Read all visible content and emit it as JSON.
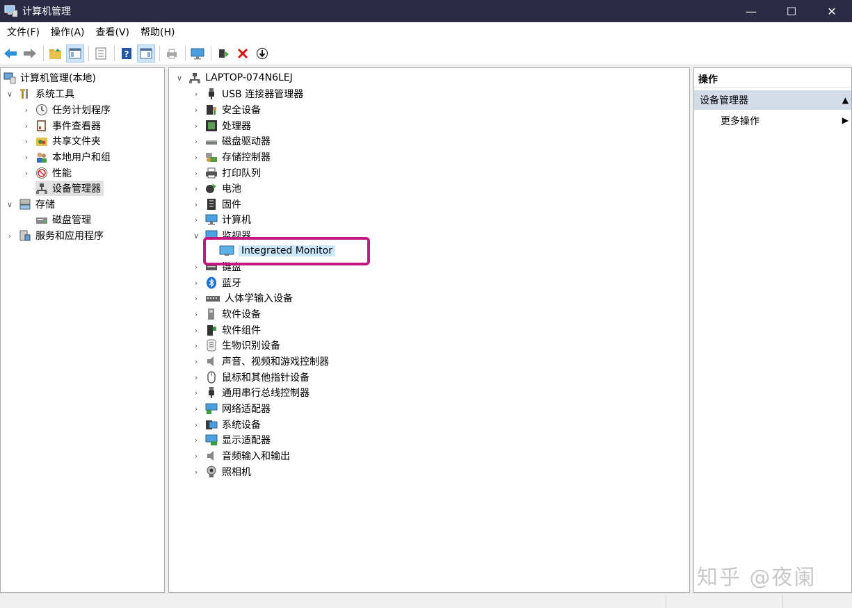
{
  "window": {
    "title": "计算机管理",
    "minimize": "—",
    "maximize": "☐",
    "close": "✕"
  },
  "menu": [
    "文件(F)",
    "操作(A)",
    "查看(V)",
    "帮助(H)"
  ],
  "left_tree": {
    "root": "计算机管理(本地)",
    "system_tools": "系统工具",
    "task_scheduler": "任务计划程序",
    "event_viewer": "事件查看器",
    "shared_folders": "共享文件夹",
    "local_users": "本地用户和组",
    "performance": "性能",
    "device_manager": "设备管理器",
    "storage": "存储",
    "disk_management": "磁盘管理",
    "services": "服务和应用程序"
  },
  "device_tree": {
    "computer": "LAPTOP-074N6LEJ",
    "categories": [
      {
        "label": "USB 连接器管理器",
        "icon": "usb-icon"
      },
      {
        "label": "安全设备",
        "icon": "security-device-icon"
      },
      {
        "label": "处理器",
        "icon": "processor-icon"
      },
      {
        "label": "磁盘驱动器",
        "icon": "disk-drive-icon"
      },
      {
        "label": "存储控制器",
        "icon": "storage-controller-icon"
      },
      {
        "label": "打印队列",
        "icon": "printer-icon"
      },
      {
        "label": "电池",
        "icon": "battery-icon"
      },
      {
        "label": "固件",
        "icon": "firmware-icon"
      },
      {
        "label": "计算机",
        "icon": "computer-icon"
      },
      {
        "label": "监视器",
        "icon": "monitor-icon",
        "expanded": true
      },
      {
        "label": "键盘",
        "icon": "keyboard-icon"
      },
      {
        "label": "蓝牙",
        "icon": "bluetooth-icon"
      },
      {
        "label": "人体学输入设备",
        "icon": "hid-icon"
      },
      {
        "label": "软件设备",
        "icon": "software-device-icon"
      },
      {
        "label": "软件组件",
        "icon": "software-component-icon"
      },
      {
        "label": "生物识别设备",
        "icon": "biometric-icon"
      },
      {
        "label": "声音、视频和游戏控制器",
        "icon": "sound-icon"
      },
      {
        "label": "鼠标和其他指针设备",
        "icon": "mouse-icon"
      },
      {
        "label": "通用串行总线控制器",
        "icon": "usb-controller-icon"
      },
      {
        "label": "网络适配器",
        "icon": "network-icon"
      },
      {
        "label": "系统设备",
        "icon": "system-device-icon"
      },
      {
        "label": "显示适配器",
        "icon": "display-adapter-icon"
      },
      {
        "label": "音频输入和输出",
        "icon": "audio-io-icon"
      },
      {
        "label": "照相机",
        "icon": "camera-icon"
      }
    ],
    "monitor_child": "Integrated Monitor"
  },
  "actions": {
    "header": "操作",
    "section": "设备管理器",
    "more": "更多操作"
  },
  "watermark": "知乎 @夜阑",
  "colors": {
    "highlight": "#c2187f",
    "selection": "#cce8ff",
    "titlebar": "#2b2b45"
  }
}
